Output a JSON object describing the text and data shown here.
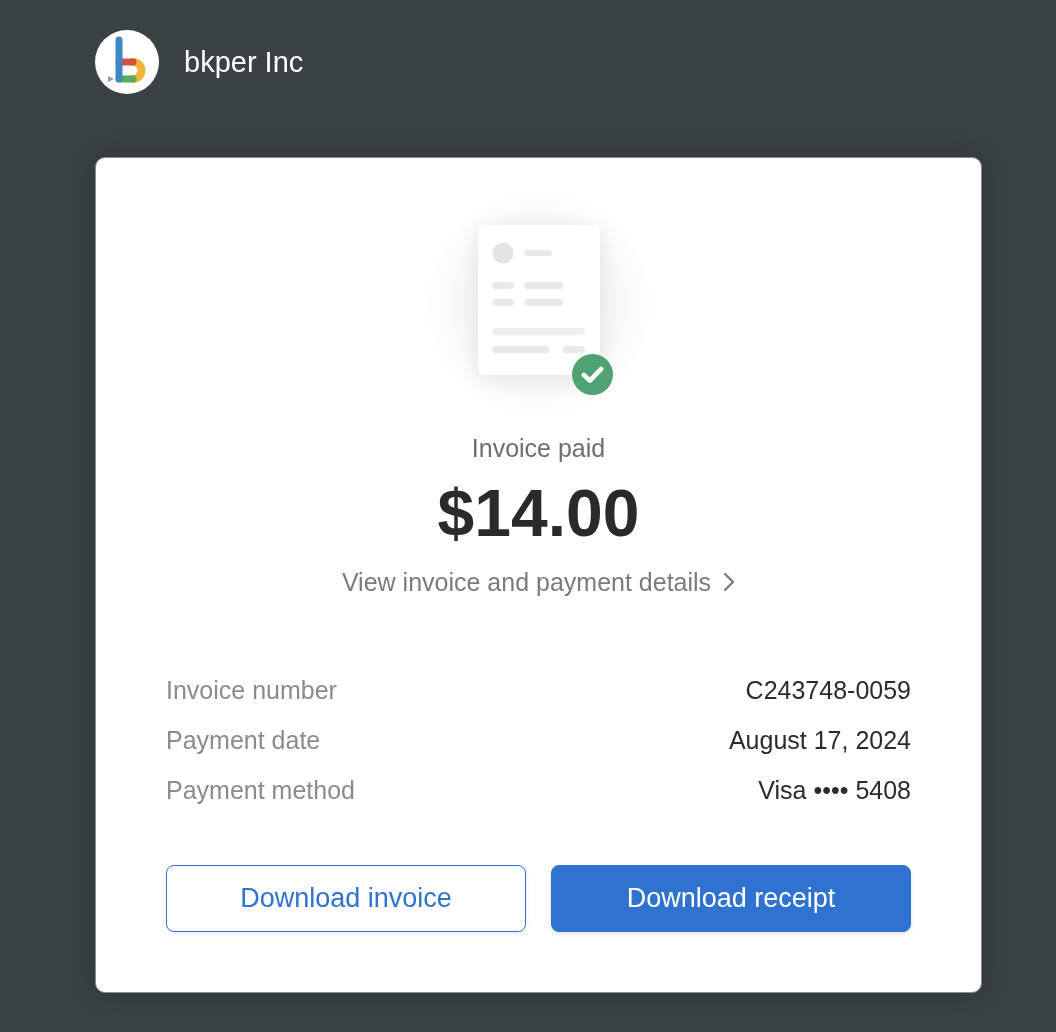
{
  "header": {
    "company_name": "bkper Inc"
  },
  "status": {
    "paid": true,
    "label": "Invoice paid",
    "amount": "$14.00",
    "details_link": "View invoice and payment details"
  },
  "details": [
    {
      "label": "Invoice number",
      "value": "C243748-0059"
    },
    {
      "label": "Payment date",
      "value": "August 17, 2024"
    },
    {
      "label": "Payment method",
      "value": "Visa •••• 5408"
    }
  ],
  "buttons": [
    {
      "label": "Download invoice",
      "kind": "outline"
    },
    {
      "label": "Download receipt",
      "kind": "primary"
    }
  ]
}
